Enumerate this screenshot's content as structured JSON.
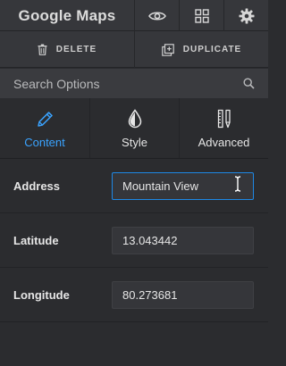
{
  "header": {
    "title": "Google Maps",
    "icons": [
      "eye-icon",
      "grid-icon",
      "gear-icon"
    ]
  },
  "actions": {
    "delete_label": "DELETE",
    "duplicate_label": "DUPLICATE"
  },
  "search": {
    "placeholder": "Search Options",
    "value": ""
  },
  "tabs": [
    {
      "label": "Content",
      "icon": "pencil-icon",
      "active": true
    },
    {
      "label": "Style",
      "icon": "drop-icon",
      "active": false
    },
    {
      "label": "Advanced",
      "icon": "tools-icon",
      "active": false
    }
  ],
  "fields": [
    {
      "label": "Address",
      "value": "Mountain View",
      "focused": true
    },
    {
      "label": "Latitude",
      "value": "13.043442",
      "focused": false
    },
    {
      "label": "Longitude",
      "value": "80.273681",
      "focused": false
    }
  ],
  "colors": {
    "accent": "#3aa3ff",
    "focus_border": "#1e88e5",
    "panel": "#2b2c2f",
    "header": "#36373b"
  }
}
